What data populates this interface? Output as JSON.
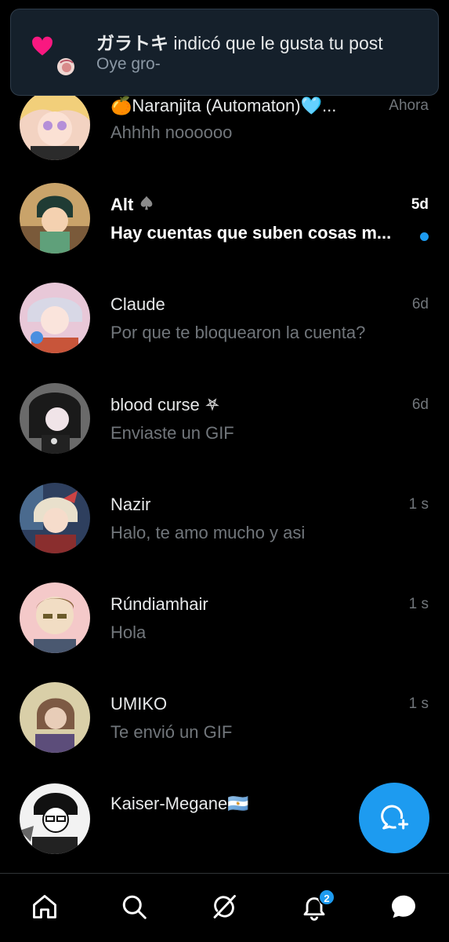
{
  "notification": {
    "user": "ガラトキ",
    "action": " indicó que le gusta tu post",
    "preview": "Oye gro-"
  },
  "conversations": [
    {
      "name": "🍊Naranjita (Automaton)🩵...",
      "time": "Ahora",
      "preview": "Ahhhh noooooo",
      "unread": false
    },
    {
      "name": "Alt",
      "time": "5d",
      "preview": "Hay cuentas que suben cosas m...",
      "unread": true
    },
    {
      "name": "Claude",
      "time": "6d",
      "preview": "Por que te bloquearon la cuenta?",
      "unread": false
    },
    {
      "name": "blood curse",
      "time": "6d",
      "preview": "Enviaste un GIF",
      "unread": false
    },
    {
      "name": "Nazir",
      "time": "1 s",
      "preview": "Halo, te amo mucho y asi",
      "unread": false
    },
    {
      "name": "Rúndiamhair",
      "time": "1 s",
      "preview": "Hola",
      "unread": false
    },
    {
      "name": "UMIKO",
      "time": "1 s",
      "preview": "Te envió un GIF",
      "unread": false
    },
    {
      "name": "Kaiser-Megane🇦🇷",
      "time": "",
      "preview": "",
      "unread": false
    }
  ],
  "fab": {
    "icon": "new-message-icon"
  },
  "bottom_nav": {
    "items": [
      "home-icon",
      "search-icon",
      "grok-icon",
      "notifications-icon",
      "messages-icon"
    ],
    "notifications_badge": "2"
  },
  "colors": {
    "accent": "#1d9bf0",
    "background": "#000000",
    "toast_bg": "#15202b",
    "text_secondary": "#71767b",
    "heart": "#f91880"
  }
}
